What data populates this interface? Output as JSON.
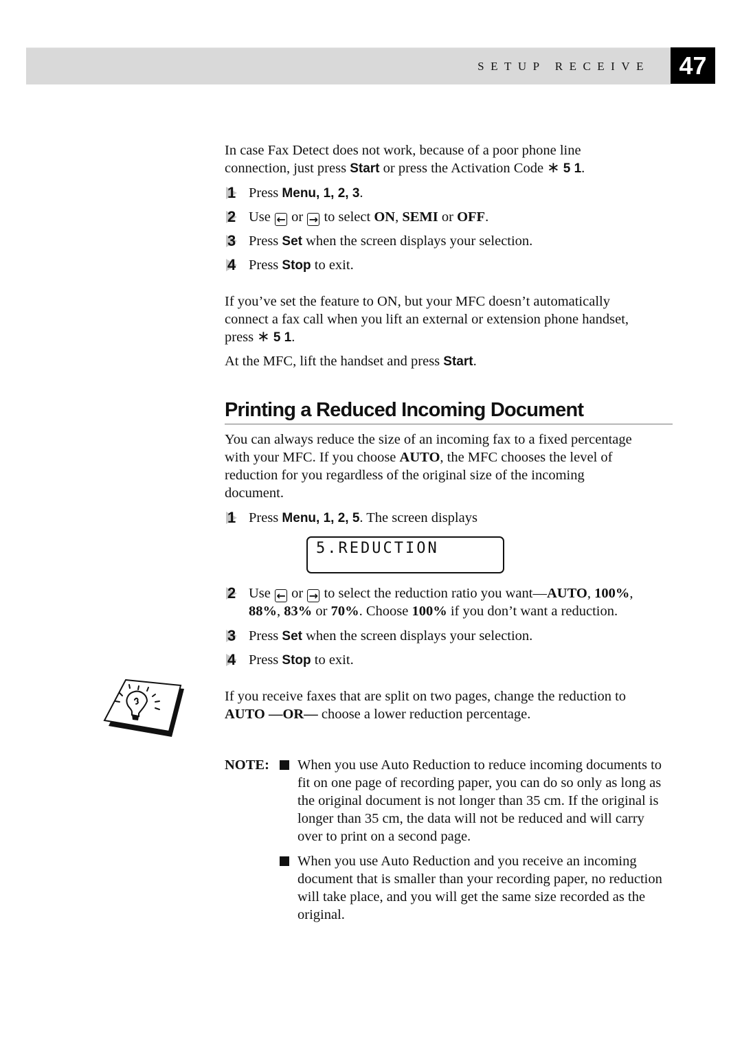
{
  "header": {
    "section_title": "SETUP RECEIVE",
    "page_number": "47"
  },
  "intro": {
    "line1": "In case Fax Detect does not work, because of a poor phone line",
    "line2_pre": "connection, just press ",
    "line2_bold": "Start",
    "line2_mid": " or press the Activation Code ",
    "code": "5 1",
    "line2_end": "."
  },
  "steps_a": [
    {
      "num": "1",
      "pre": "Press ",
      "menu": "Menu",
      "keys": ", 1, 2, 3",
      "end": "."
    },
    {
      "num": "2",
      "pre": "Use ",
      "or": " or ",
      "mid": " to select ",
      "opt1": "ON",
      "sep": ", ",
      "opt2": "SEMI",
      "or2": " or ",
      "opt3": "OFF",
      "end": "."
    },
    {
      "num": "3",
      "pre": "Press ",
      "bold": "Set",
      "post": " when the screen displays your selection."
    },
    {
      "num": "4",
      "pre": "Press ",
      "bold": "Stop",
      "post": " to exit."
    }
  ],
  "para_on": {
    "line1": "If you’ve set the feature to ON, but your MFC doesn’t automatically",
    "line2": "connect a fax call when you lift an external or extension phone handset,",
    "line3_pre": "press ",
    "code": "5 1",
    "line3_end": "."
  },
  "para_mfc": {
    "pre": "At the MFC, lift the handset and press ",
    "bold": "Start",
    "end": "."
  },
  "section": {
    "title": "Printing a Reduced Incoming Document",
    "p_line1": "You can always reduce the size of an incoming fax to a fixed percentage",
    "p_line2_pre": "with your MFC. If you choose ",
    "p_line2_bold": "AUTO",
    "p_line2_post": ", the MFC chooses the level of",
    "p_line3": "reduction for you regardless of the original size of the incoming",
    "p_line4": "document."
  },
  "steps_b": [
    {
      "num": "1",
      "pre": "Press ",
      "menu": "Menu",
      "keys": ", 1, 2, 5",
      "post": ". The screen displays"
    },
    {
      "num": "2",
      "pre": "Use ",
      "or": " or ",
      "mid": " to select the reduction ratio you want—",
      "o1": "AUTO",
      "o2": "100%",
      "o3": "88%",
      "o4": "83%",
      "o5": "70%",
      "choose": ". Choose ",
      "o6": "100%",
      "tail": " if you don’t want a reduction."
    },
    {
      "num": "3",
      "pre": "Press ",
      "bold": "Set",
      "post": " when the screen displays your selection."
    },
    {
      "num": "4",
      "pre": "Press ",
      "bold": "Stop",
      "post": " to exit."
    }
  ],
  "lcd_display": "5.REDUCTION",
  "tip": {
    "line1": "If you receive faxes that are split on two pages, change the reduction to",
    "b1": "AUTO",
    "b2": " —OR—",
    "post": " choose a lower reduction percentage."
  },
  "note": {
    "label": "NOTE:",
    "items": [
      "When you use Auto Reduction to reduce incoming documents to fit on one page of recording paper, you can do so only as long as the original document is not longer than 35 cm. If the original is longer than 35 cm, the data will not be reduced and will carry over to print on a second page.",
      "When you use Auto Reduction and you receive an incoming document that is smaller than your recording paper, no reduction will take place, and you will get the same size recorded as the original."
    ]
  },
  "icons": {
    "left_key": "←",
    "right_key": "→",
    "star": "∗"
  }
}
